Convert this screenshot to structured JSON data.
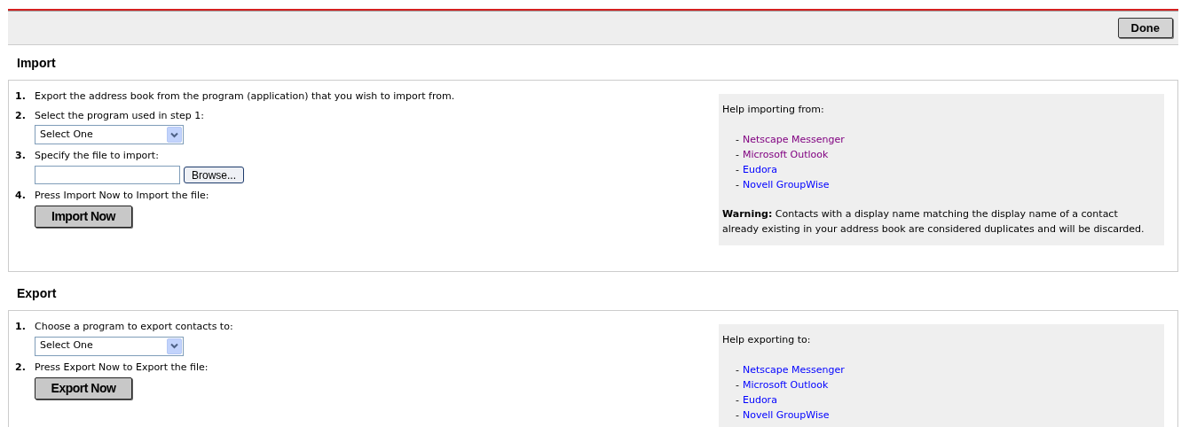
{
  "toolbar": {
    "done_button": "Done"
  },
  "sections": [
    {
      "title": "Import",
      "steps": [
        {
          "number": "1.",
          "text": "Export the address book from the program (application) that you wish to import from."
        },
        {
          "number": "2.",
          "text": "Select the program used in step 1:",
          "control": {
            "kind": "select",
            "value": "Select One"
          }
        },
        {
          "number": "3.",
          "text": "Specify the file to import:",
          "control": {
            "kind": "file",
            "button": "Browse..."
          }
        },
        {
          "number": "4.",
          "text": "Press Import Now to Import the file:",
          "control": {
            "kind": "button",
            "label": "Import Now"
          }
        }
      ],
      "help": {
        "heading": "Help importing from:",
        "links": [
          {
            "dash": "-",
            "label": "Netscape Messenger",
            "visited": true
          },
          {
            "dash": "-",
            "label": "Microsoft Outlook",
            "visited": true
          },
          {
            "dash": "-",
            "label": "Eudora",
            "visited": false
          },
          {
            "dash": "-",
            "label": "Novell GroupWise",
            "visited": false
          }
        ],
        "warning": "**Warning:** Contacts with a display name matching the display name of a contact already existing in your address book are considered duplicates and will be discarded."
      }
    },
    {
      "title": "Export",
      "steps": [
        {
          "number": "1.",
          "text": "Choose a program to export contacts to:",
          "control": {
            "kind": "select",
            "value": "Select One"
          }
        },
        {
          "number": "2.",
          "text": "Press Export Now to Export the file:",
          "control": {
            "kind": "button",
            "label": "Export Now"
          }
        }
      ],
      "help": {
        "heading": "Help exporting to:",
        "links": [
          {
            "dash": "-",
            "label": "Netscape Messenger",
            "visited": false
          },
          {
            "dash": "-",
            "label": "Microsoft Outlook",
            "visited": false
          },
          {
            "dash": "-",
            "label": "Eudora",
            "visited": false
          },
          {
            "dash": "-",
            "label": "Novell GroupWise",
            "visited": false
          }
        ]
      }
    }
  ]
}
